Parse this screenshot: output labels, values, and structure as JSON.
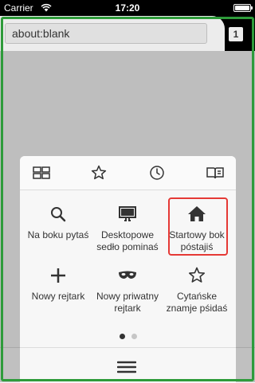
{
  "status_bar": {
    "carrier": "Carrier",
    "time": "17:20"
  },
  "browser": {
    "url": "about:blank",
    "tab_count": "1"
  },
  "menu": {
    "tabs": [
      {
        "icon": "top-sites-grid-icon"
      },
      {
        "icon": "bookmarks-star-icon"
      },
      {
        "icon": "history-clock-icon"
      },
      {
        "icon": "reading-list-book-icon"
      }
    ],
    "tiles": [
      {
        "label": "Na boku pytaś",
        "icon": "search-icon"
      },
      {
        "label": "Desktopowe sedło pominaś",
        "icon": "desktop-icon"
      },
      {
        "label": "Startowy bok póstajiś",
        "icon": "home-icon"
      },
      {
        "label": "Nowy rejtark",
        "icon": "plus-icon"
      },
      {
        "label": "Nowy priwatny rejtark",
        "icon": "private-mask-icon"
      },
      {
        "label": "Cytańske znamje pśidaś",
        "icon": "star-icon"
      }
    ],
    "page_indicator": {
      "current": 1,
      "total": 2
    },
    "bottom_icon": "hamburger-menu-icon"
  },
  "colors": {
    "focus_border": "#2e9b3a",
    "highlight_border": "#e53935",
    "icon": "#333333"
  }
}
